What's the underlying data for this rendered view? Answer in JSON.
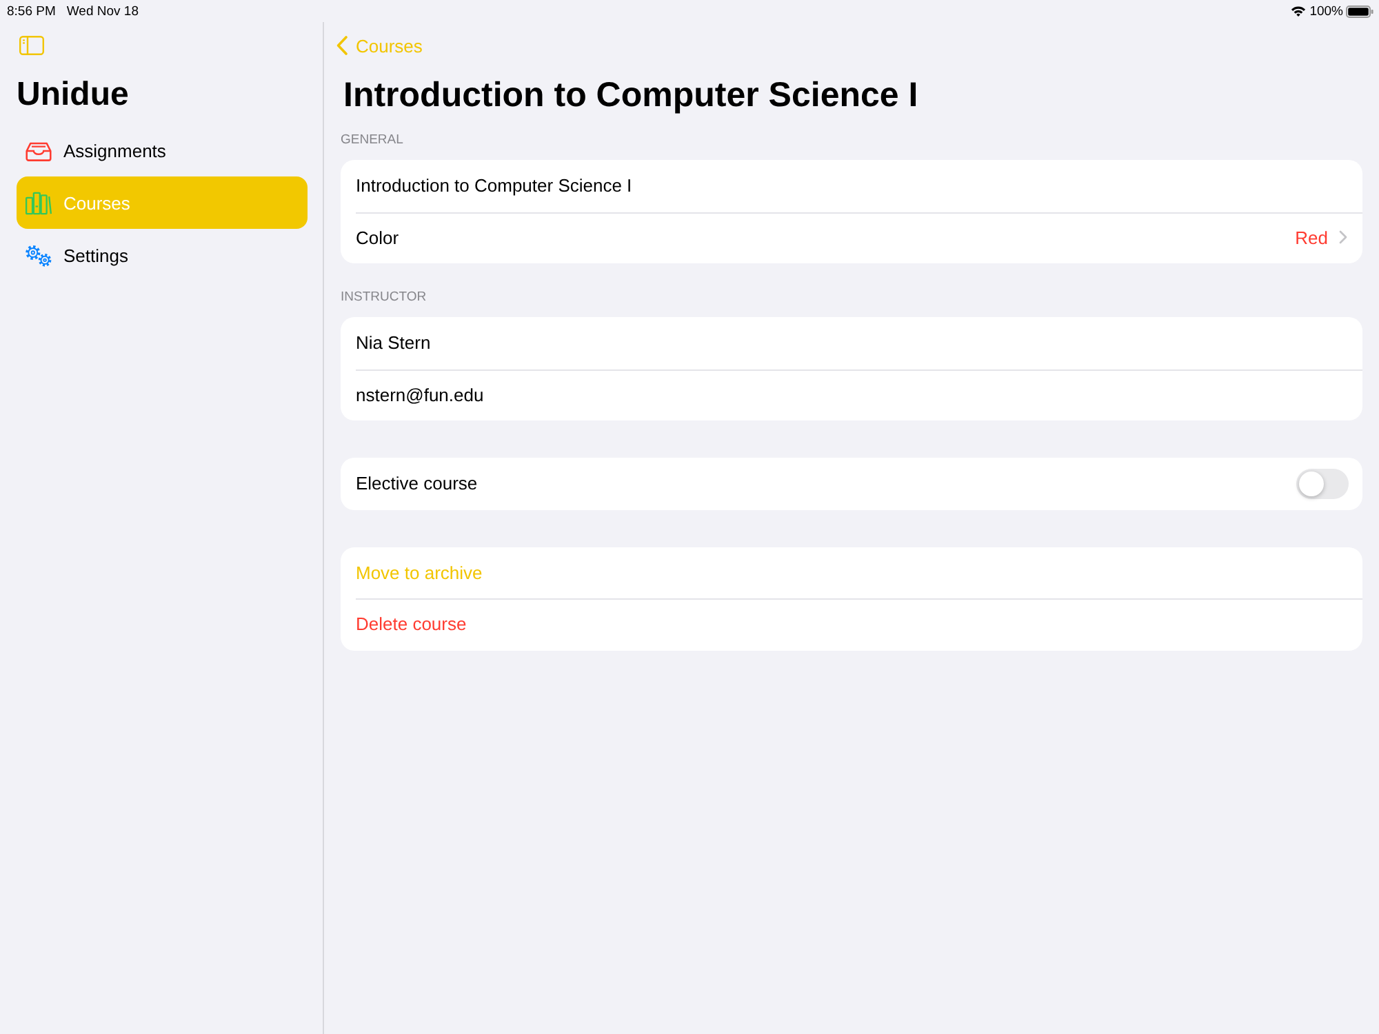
{
  "status_bar": {
    "time": "8:56 PM",
    "date": "Wed Nov 18",
    "battery": "100%"
  },
  "sidebar": {
    "title": "Unidue",
    "items": [
      {
        "label": "Assignments",
        "kind": "tray",
        "selected": false
      },
      {
        "label": "Courses",
        "kind": "books",
        "selected": true
      },
      {
        "label": "Settings",
        "kind": "gears",
        "selected": false
      }
    ]
  },
  "navigation": {
    "back": "Courses",
    "title": "Introduction to Computer Science I"
  },
  "sections": [
    {
      "header": "GENERAL",
      "rows": [
        {
          "kind": "field",
          "value": "Introduction to Computer Science I"
        },
        {
          "kind": "detail",
          "label": "Color",
          "value": "Red",
          "color": "#ff3b30"
        }
      ]
    },
    {
      "header": "INSTRUCTOR",
      "rows": [
        {
          "kind": "field",
          "value": "Nia Stern"
        },
        {
          "kind": "field",
          "value": "nstern@fun.edu"
        }
      ]
    },
    {
      "rows": [
        {
          "kind": "toggle",
          "label": "Elective course",
          "on": false
        }
      ]
    },
    {
      "rows": [
        {
          "kind": "action",
          "label": "Move to archive"
        },
        {
          "kind": "destructive",
          "label": "Delete course"
        }
      ]
    }
  ]
}
